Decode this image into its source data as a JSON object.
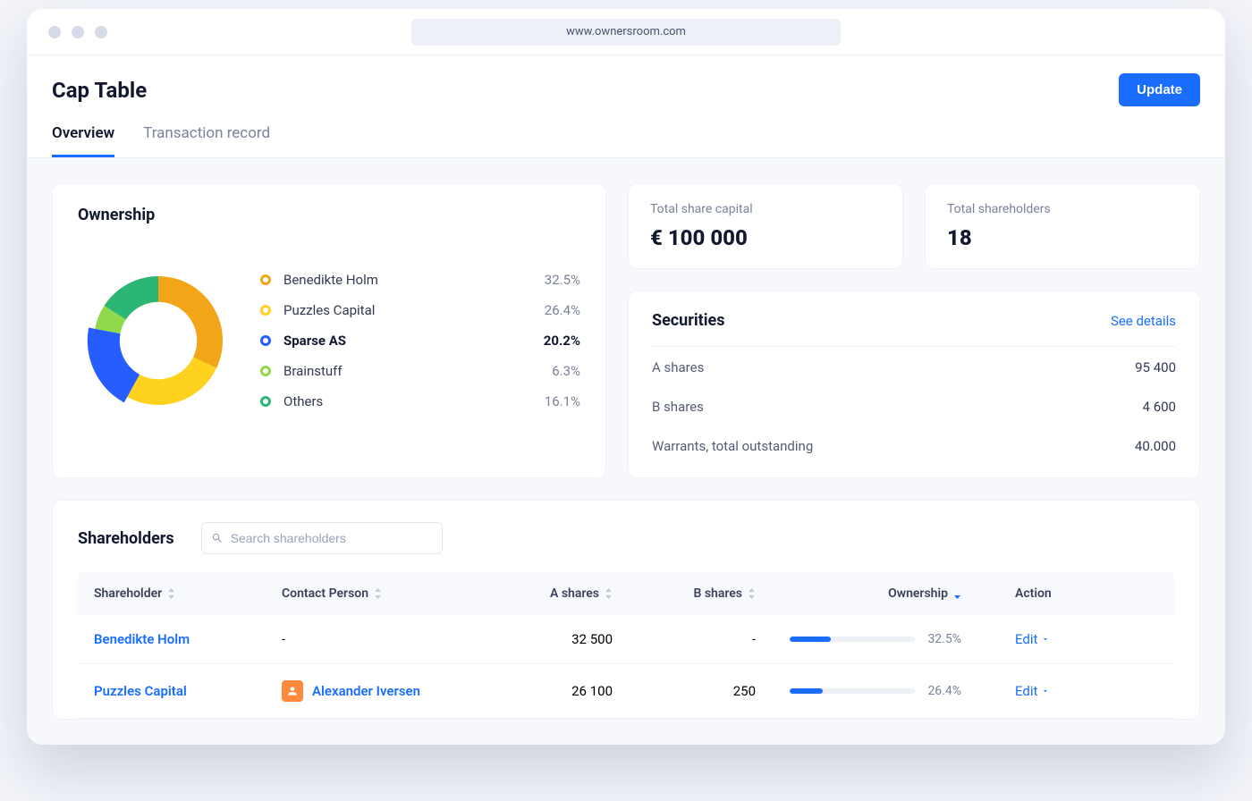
{
  "browser": {
    "url": "www.ownersroom.com"
  },
  "header": {
    "title": "Cap Table",
    "update_button": "Update"
  },
  "tabs": {
    "items": [
      {
        "label": "Overview",
        "active": true
      },
      {
        "label": "Transaction record",
        "active": false
      }
    ]
  },
  "ownership_card": {
    "title": "Ownership"
  },
  "chart_data": {
    "type": "pie",
    "title": "Ownership",
    "series": [
      {
        "name": "Benedikte Holm",
        "value": 32.5,
        "color": "#f2a516"
      },
      {
        "name": "Puzzles Capital",
        "value": 26.4,
        "color": "#ffd21f"
      },
      {
        "name": "Sparse AS",
        "value": 20.2,
        "color": "#255dff",
        "highlighted": true
      },
      {
        "name": "Brainstuff",
        "value": 6.3,
        "color": "#8fd94a"
      },
      {
        "name": "Others",
        "value": 16.1,
        "color": "#2bb673"
      }
    ]
  },
  "ownership_legend": [
    {
      "name": "Benedikte Holm",
      "pct": "32.5%",
      "color": "#f2a516",
      "bold": false
    },
    {
      "name": "Puzzles Capital",
      "pct": "26.4%",
      "color": "#ffd21f",
      "bold": false
    },
    {
      "name": "Sparse AS",
      "pct": "20.2%",
      "color": "#255dff",
      "bold": true
    },
    {
      "name": "Brainstuff",
      "pct": "6.3%",
      "color": "#8fd94a",
      "bold": false
    },
    {
      "name": "Others",
      "pct": "16.1%",
      "color": "#2bb673",
      "bold": false
    }
  ],
  "stats": {
    "capital": {
      "label": "Total share capital",
      "value": "€ 100 000"
    },
    "shareholders": {
      "label": "Total shareholders",
      "value": "18"
    }
  },
  "securities": {
    "title": "Securities",
    "see_details": "See details",
    "rows": [
      {
        "label": "A shares",
        "value": "95 400"
      },
      {
        "label": "B shares",
        "value": "4 600"
      },
      {
        "label": "Warrants, total outstanding",
        "value": "40.000"
      }
    ]
  },
  "shareholders": {
    "title": "Shareholders",
    "search_placeholder": "Search shareholders",
    "columns": {
      "shareholder": "Shareholder",
      "contact": "Contact Person",
      "a_shares": "A shares",
      "b_shares": "B shares",
      "ownership": "Ownership",
      "action": "Action"
    },
    "edit_label": "Edit",
    "rows": [
      {
        "name": "Benedikte Holm",
        "contact": "-",
        "has_avatar": false,
        "a_shares": "32 500",
        "b_shares": "-",
        "ownership_pct": "32.5%",
        "bar_pct": 32.5
      },
      {
        "name": "Puzzles Capital",
        "contact": "Alexander Iversen",
        "has_avatar": true,
        "a_shares": "26 100",
        "b_shares": "250",
        "ownership_pct": "26.4%",
        "bar_pct": 26.4
      }
    ]
  }
}
